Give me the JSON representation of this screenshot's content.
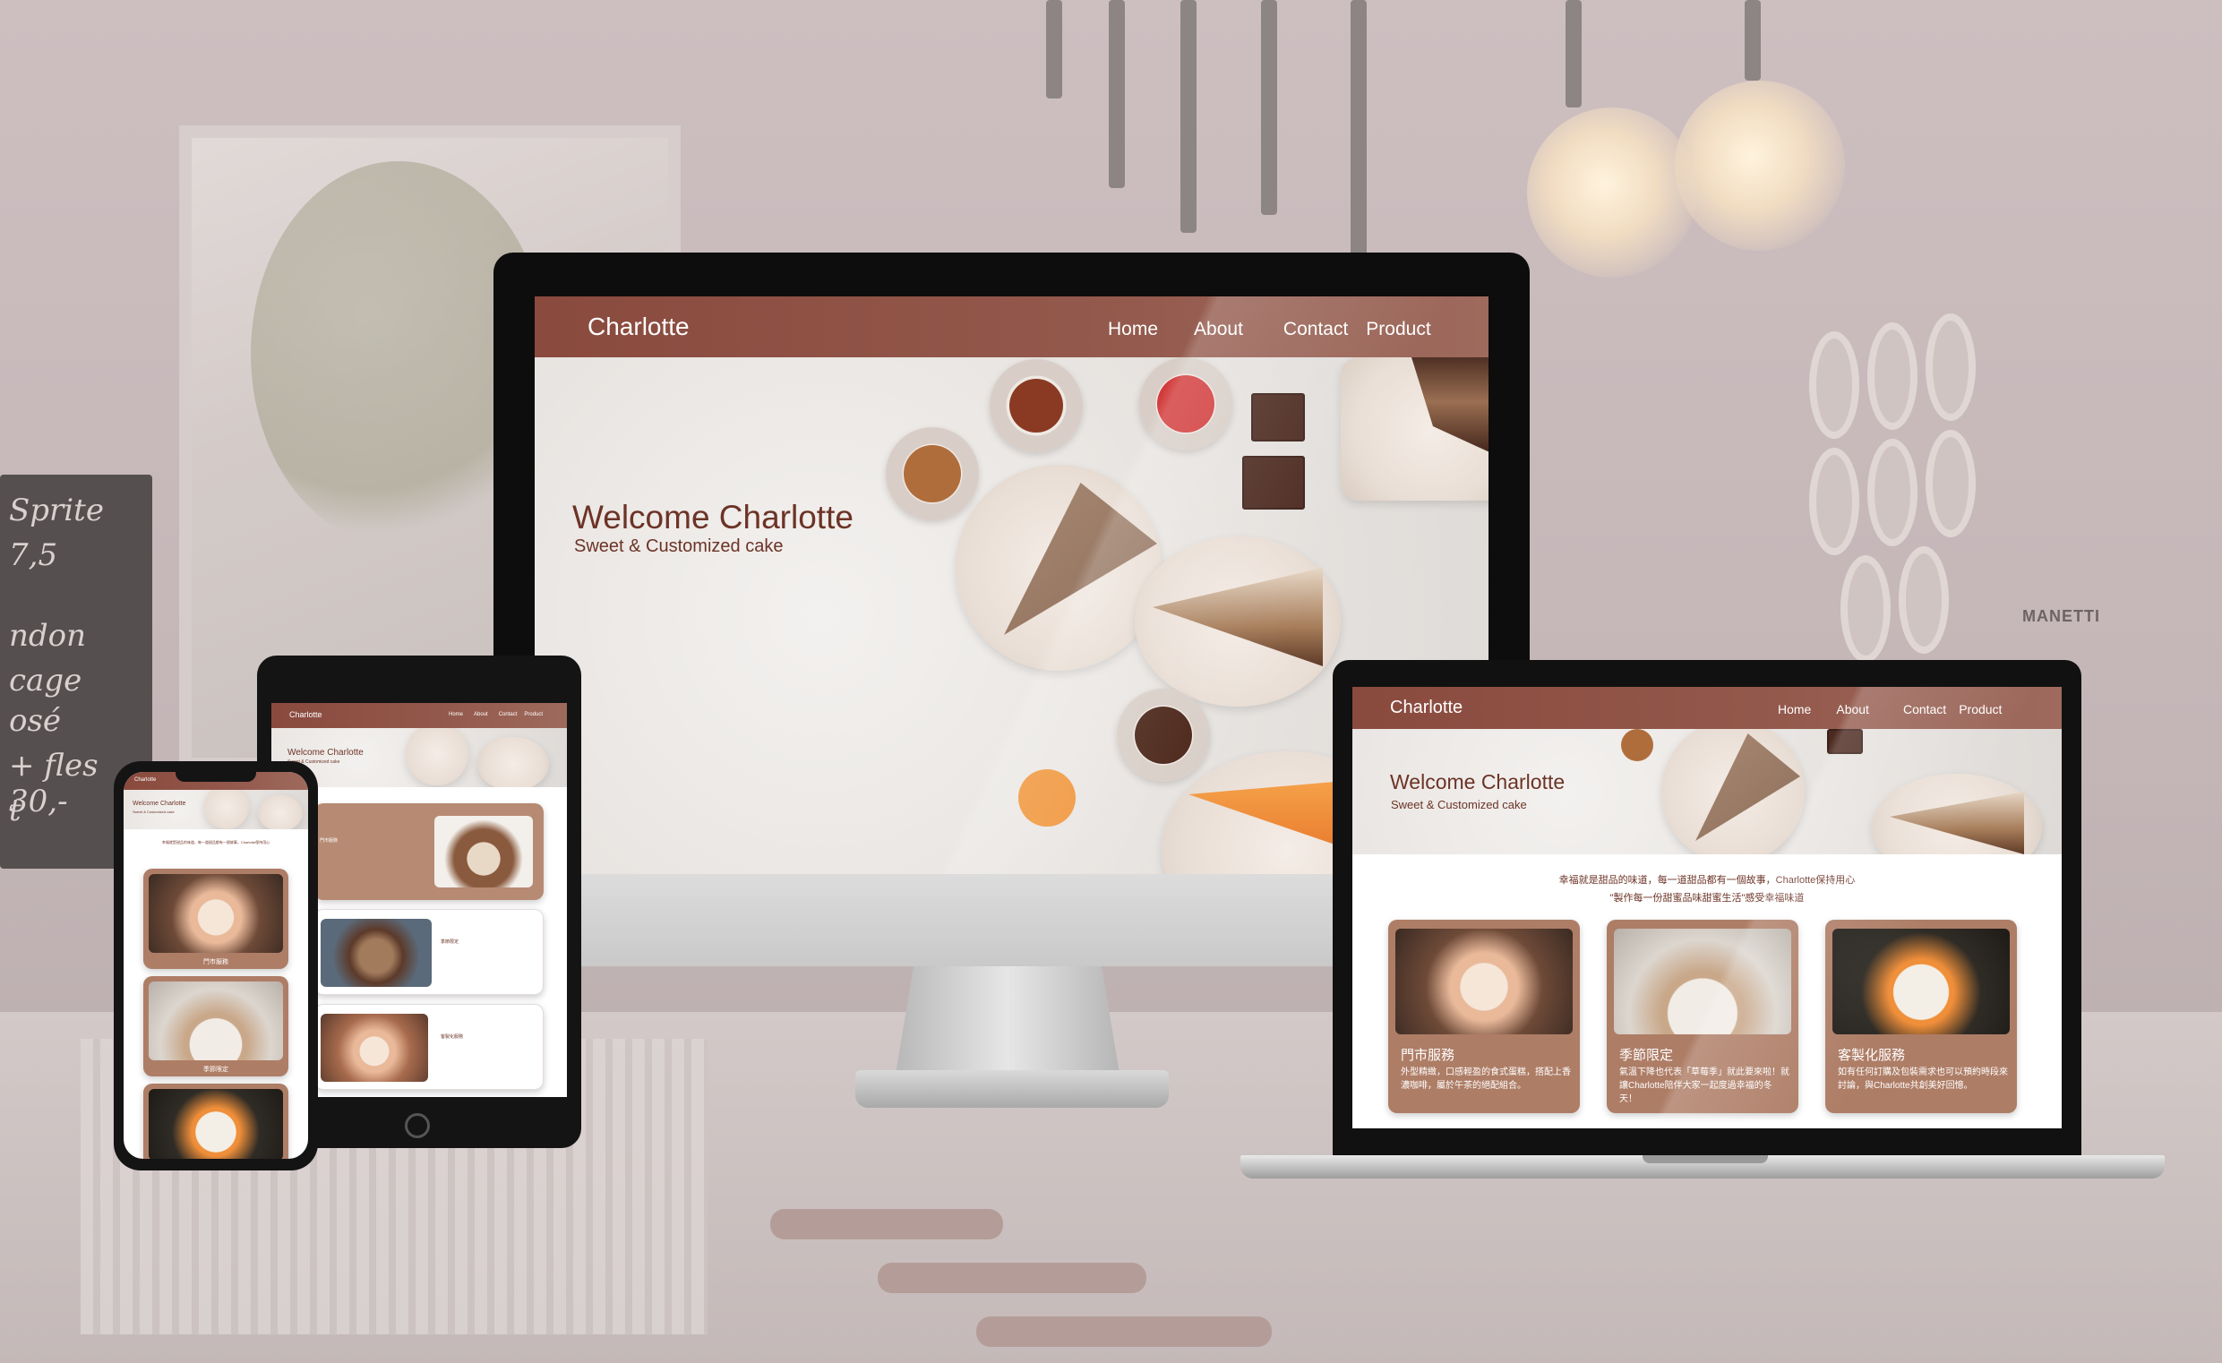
{
  "desktop": {
    "brand": "Charlotte",
    "nav": [
      "Home",
      "About",
      "Contact",
      "Product"
    ],
    "hero_title": "Welcome Charlotte",
    "hero_subtitle": "Sweet & Customized cake"
  },
  "laptop": {
    "brand": "Charlotte",
    "nav": [
      "Home",
      "About",
      "Contact",
      "Product"
    ],
    "hero_title": "Welcome Charlotte",
    "hero_subtitle": "Sweet & Customized cake",
    "intro_line1": "幸福就是甜品的味道，每一道甜品都有一個故事，Charlotte保持用心",
    "intro_line2": "\"製作每一份甜蜜品味甜蜜生活\"感受幸福味道",
    "cards": [
      {
        "title": "門市服務",
        "text": "外型精緻，口感輕盈的食式蛋糕，搭配上香濃咖啡，屬於午茶的絕配組合。"
      },
      {
        "title": "季節限定",
        "text": "氣溫下降也代表「草莓季」就此要來啦！就讓Charlotte陪伴大家一起度過幸福的冬天！"
      },
      {
        "title": "客製化服務",
        "text": "如有任何訂購及包裝需求也可以預約時段來討論，與Charlotte共創美好回憶。"
      }
    ]
  },
  "tablet": {
    "brand": "Charlotte",
    "nav": [
      "Home",
      "About",
      "Contact",
      "Product"
    ],
    "hero_title": "Welcome Charlotte",
    "hero_subtitle": "Sweet & Customized cake",
    "rows": [
      {
        "title": "門市服務"
      },
      {
        "title": "季節限定"
      },
      {
        "title": "客製化服務"
      }
    ]
  },
  "phone": {
    "brand": "Charlotte",
    "hero_title": "Welcome Charlotte",
    "hero_subtitle": "Sweet & Customized cake",
    "intro": "幸福就是甜品的味道，每一道甜品都有一個故事，Charlotte保持用心",
    "cards": [
      {
        "title": "門市服務"
      },
      {
        "title": "季節限定"
      }
    ]
  },
  "background": {
    "board_lines": [
      "Sprite",
      "7,5",
      "ndon",
      "cage",
      "osé",
      "+ fles 30,-",
      "t"
    ],
    "machine_label": "MANETTI"
  },
  "colors": {
    "nav_brown": "#8a4a3e",
    "card_brown": "#ae7d66",
    "title_brown": "#6c3326"
  }
}
